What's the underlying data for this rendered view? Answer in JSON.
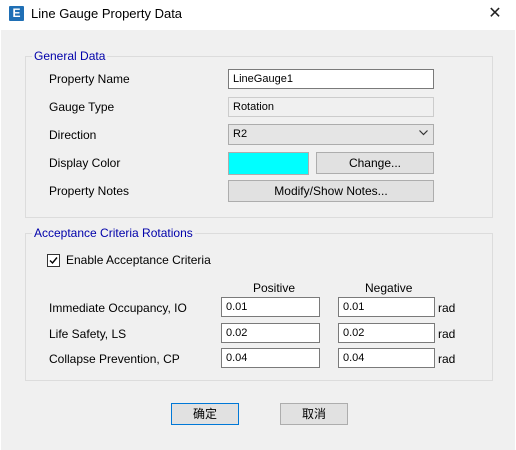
{
  "window": {
    "title": "Line Gauge Property Data",
    "app_icon_letter": "E",
    "close_glyph": "✕"
  },
  "general": {
    "legend": "General Data",
    "property_name_label": "Property Name",
    "property_name_value": "LineGauge1",
    "gauge_type_label": "Gauge Type",
    "gauge_type_value": "Rotation",
    "direction_label": "Direction",
    "direction_value": "R2",
    "display_color_label": "Display Color",
    "display_color": "#00ffff",
    "change_button": "Change...",
    "property_notes_label": "Property Notes",
    "notes_button": "Modify/Show Notes..."
  },
  "acceptance": {
    "legend": "Acceptance Criteria Rotations",
    "enable_label": "Enable Acceptance Criteria",
    "enable_checked": true,
    "positive_header": "Positive",
    "negative_header": "Negative",
    "rows": [
      {
        "label": "Immediate Occupancy, IO",
        "positive": "0.01",
        "negative": "0.01",
        "unit": "rad"
      },
      {
        "label": "Life Safety, LS",
        "positive": "0.02",
        "negative": "0.02",
        "unit": "rad"
      },
      {
        "label": "Collapse Prevention, CP",
        "positive": "0.04",
        "negative": "0.04",
        "unit": "rad"
      }
    ]
  },
  "buttons": {
    "ok": "确定",
    "cancel": "取消"
  },
  "colors": {
    "legend_text": "#0000aa",
    "dialog_bg": "#f0f0f0"
  }
}
